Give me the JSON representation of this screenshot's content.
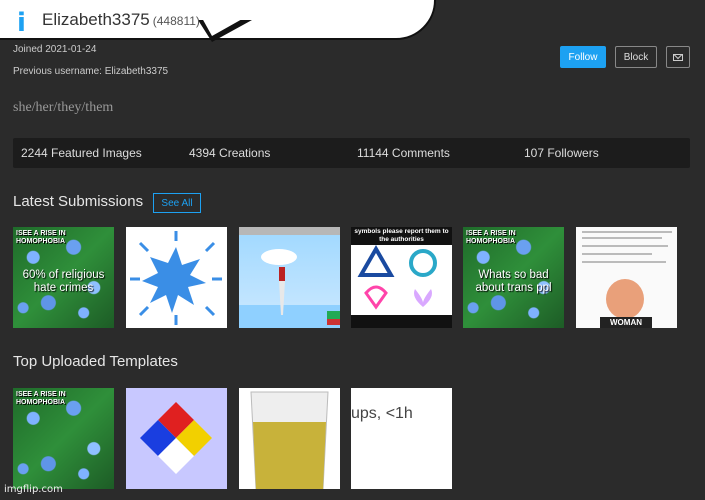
{
  "profile": {
    "username": "Elizabeth3375",
    "user_id": "(448811)",
    "joined": "Joined 2021-01-24",
    "previous_username": "Previous username: Elizabeth3375",
    "pronouns": "she/her/they/them"
  },
  "actions": {
    "follow": "Follow",
    "block": "Block"
  },
  "stats": {
    "featured": "2244 Featured Images",
    "creations": "4394 Creations",
    "comments": "11144 Comments",
    "followers": "107 Followers"
  },
  "latest": {
    "title": "Latest Submissions",
    "see_all": "See All",
    "items": [
      {
        "top": "ISEE A RISE IN HOMOPHOBIA",
        "text": "60% of religious hate crimes"
      },
      {
        "top": ""
      },
      {
        "top": ""
      },
      {
        "top": "symbols please report them to the authorities"
      },
      {
        "top": "ISEE A RISE IN HOMOPHOBIA",
        "text": "Whats so bad about trans ppl"
      },
      {
        "top": "",
        "bottom": "WOMAN"
      }
    ]
  },
  "templates": {
    "title": "Top Uploaded Templates",
    "items": [
      {
        "top": "ISEE A RISE IN HOMOPHOBIA"
      },
      {
        "top": ""
      },
      {
        "top": ""
      },
      {
        "text": "ups, <1h"
      }
    ]
  },
  "watermark": "imgflip.com",
  "colors": {
    "accent": "#1da1f2",
    "background": "#2b2b2b",
    "stats_bar": "#1c1c1c"
  }
}
